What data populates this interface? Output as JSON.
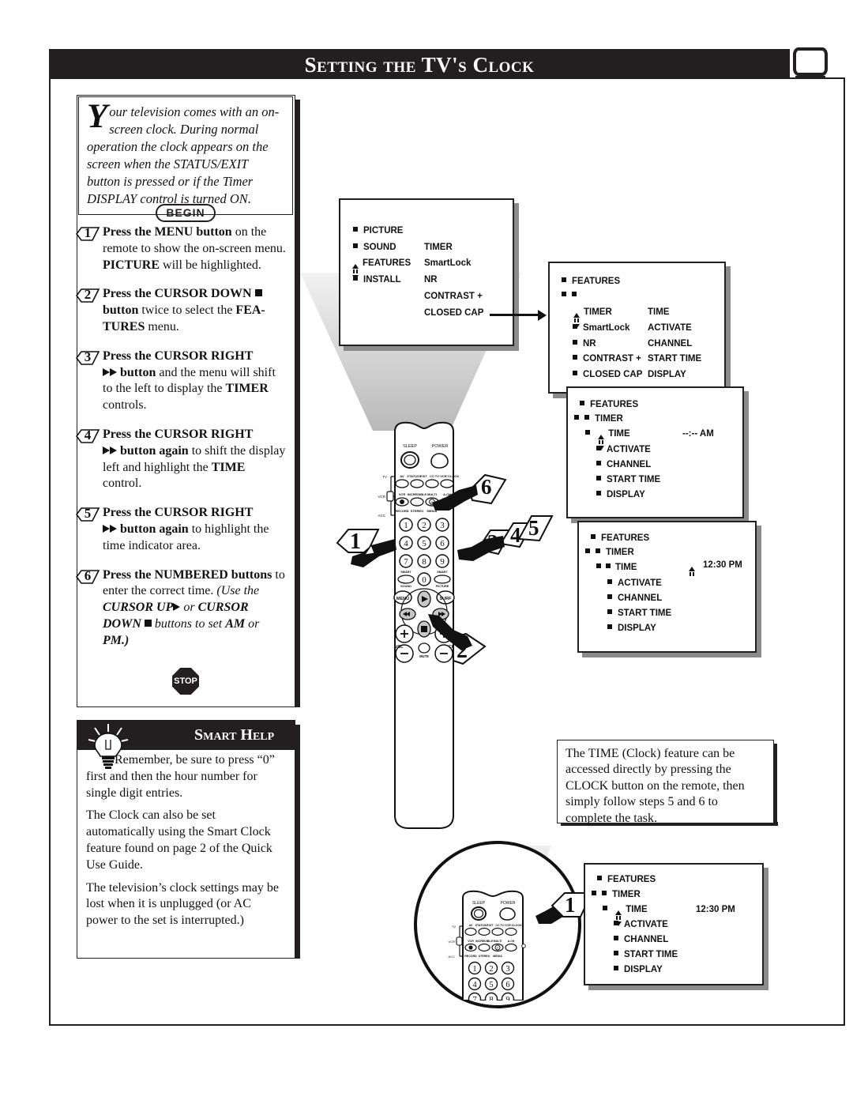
{
  "header": {
    "title": "Setting the TV's Clock",
    "tv_icon": "tv-icon"
  },
  "intro": {
    "dropcap": "Y",
    "text": "our television comes with an on-screen clock. During normal operation the clock appears on the screen when the STATUS/EXIT button is pressed or if the Timer DISPLAY control is turned ON."
  },
  "begin_label": "BEGIN",
  "stop_label": "STOP",
  "steps": [
    {
      "num": "1",
      "lead": "Press the MENU button",
      "rest": " on the remote to show the on-screen menu. ",
      "bold2": "PICTURE",
      "tail": " will be highlighted."
    },
    {
      "num": "2",
      "lead": "Press the CURSOR DOWN",
      "icon": "down-square-icon",
      "bold_after": "button",
      "rest": " twice to select the ",
      "bold2": "FEA-TURES",
      "tail": " menu."
    },
    {
      "num": "3",
      "lead": "Press the CURSOR RIGHT",
      "icon": "double-right-arrow-icon",
      "bold_after": "button",
      "rest": " and the menu will shift to the left to display the ",
      "bold2": "TIMER",
      "tail": " controls."
    },
    {
      "num": "4",
      "lead": "Press the CURSOR RIGHT",
      "icon": "double-right-arrow-icon",
      "bold_after": "button again",
      "rest": " to shift the display left and highlight the ",
      "bold2": "TIME",
      "tail": " control."
    },
    {
      "num": "5",
      "lead": "Press the CURSOR RIGHT",
      "icon": "double-right-arrow-icon",
      "bold_after": "button again",
      "rest": " to highlight the time indicator area.",
      "bold2": "",
      "tail": ""
    },
    {
      "num": "6",
      "lead": "Press the NUMBERED buttons",
      "rest": " to enter the correct time. ",
      "italic_note_a": "(Use the ",
      "italic_bold_a": "CURSOR UP",
      "italic_icon_a": "right-triangle-icon",
      "italic_note_b": " or ",
      "italic_bold_b": "CURSOR DOWN",
      "italic_icon_b": "down-square-icon",
      "italic_note_c": " buttons to set ",
      "italic_bold_c": "AM",
      "italic_note_d": " or ",
      "italic_bold_d": "PM.)"
    }
  ],
  "smart_help": {
    "title": "Smart Help",
    "icon": "lightbulb-icon",
    "paragraphs": [
      "Remember, be sure to press “0” first and then the hour number for single digit entries.",
      "The Clock can also be set automatically using the Smart Clock feature found on page 2 of the Quick Use Guide.",
      "The television’s clock settings may be lost when it is unplugged (or AC power to the set is interrupted.)"
    ]
  },
  "info_box": {
    "text": "The TIME (Clock) feature can be accessed directly by pressing the CLOCK button on the remote, then simply follow steps 5 and 6 to complete the task."
  },
  "menus": [
    {
      "id": "menu-main",
      "left_items": [
        "PICTURE",
        "SOUND",
        "FEATURES",
        "INSTALL"
      ],
      "right_items": [
        "TIMER",
        "SmartLock",
        "NR",
        "CONTRAST +",
        "CLOSED CAP"
      ],
      "cursor_on": "FEATURES"
    },
    {
      "id": "menu-features",
      "header": "FEATURES",
      "left_items": [
        "TIMER",
        "SmartLock",
        "NR",
        "CONTRAST +",
        "CLOSED CAP"
      ],
      "right_items": [
        "TIME",
        "ACTIVATE",
        "CHANNEL",
        "START TIME",
        "DISPLAY"
      ],
      "cursor_on": "TIMER"
    },
    {
      "id": "menu-timer-blank",
      "header": "FEATURES",
      "subheader": "TIMER",
      "items": [
        "TIME",
        "ACTIVATE",
        "CHANNEL",
        "START TIME",
        "DISPLAY"
      ],
      "value": "--:-- AM",
      "cursor_on": "TIME"
    },
    {
      "id": "menu-timer-set",
      "header": "FEATURES",
      "subheader": "TIMER",
      "items": [
        "TIME",
        "ACTIVATE",
        "CHANNEL",
        "START TIME",
        "DISPLAY"
      ],
      "value": "12:30 PM",
      "cursor_on": "TIME"
    },
    {
      "id": "menu-timer-clock",
      "header": "FEATURES",
      "subheader": "TIMER",
      "items": [
        "TIME",
        "ACTIVATE",
        "CHANNEL",
        "START TIME",
        "DISPLAY"
      ],
      "value": "12:30 PM",
      "cursor_on": "TIME"
    }
  ],
  "remote": {
    "sleep_label": "SLEEP",
    "power_label": "POWER",
    "mode_labels": [
      "TV",
      "VCR",
      "ACC"
    ],
    "row1": [
      "AV",
      "STATUS/EXIT",
      "CC",
      "TV·VCR·CLOCK"
    ],
    "row2_top": [
      "VCR",
      "INCREDIBLE",
      "MULTI",
      "A.CH"
    ],
    "row2_bottom": [
      "RECORD",
      "STEREO",
      "MEDIA"
    ],
    "keypad": [
      "1",
      "2",
      "3",
      "4",
      "5",
      "6",
      "7",
      "8",
      "9",
      "0"
    ],
    "smart_sound": "SMART SOUND",
    "smart_picture": "SMART PICTURE",
    "menu_label": "MENU",
    "surf_label": "SURF",
    "vol_label": "VOL",
    "ch_label": "CH",
    "mute_label": "MUTE"
  },
  "callouts": {
    "c1": "1",
    "c2": "2",
    "c3": "3",
    "c4": "4",
    "c5": "5",
    "c6": "6",
    "zoom1": "1"
  },
  "colors": {
    "ink": "#231f20",
    "shadow": "#8b8b8b",
    "beam": "#c9c9c9"
  }
}
